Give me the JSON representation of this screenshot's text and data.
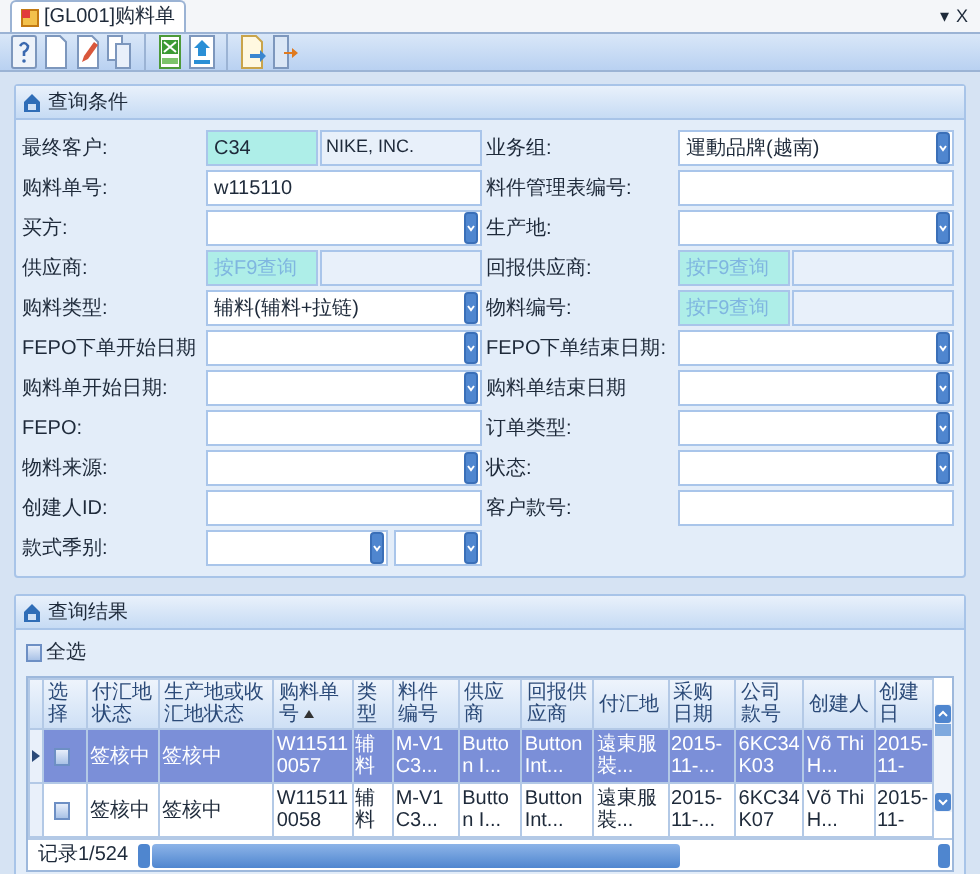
{
  "tab": {
    "title": "[GL001]购料单",
    "selected": true
  },
  "window_controls": [
    "▾",
    "X"
  ],
  "query_panel": {
    "title": "查询条件",
    "rows": [
      {
        "left": {
          "label": "最终客户:",
          "kind": "lookup",
          "code": "C34",
          "name": "NIKE, INC."
        },
        "right": {
          "label": "业务组:",
          "kind": "select",
          "value": "運動品牌(越南)"
        }
      },
      {
        "left": {
          "label": "购料单号:",
          "kind": "text",
          "value": "w115110"
        },
        "right": {
          "label": "料件管理表编号:",
          "kind": "text"
        }
      },
      {
        "left": {
          "label": "买方:",
          "kind": "select"
        },
        "right": {
          "label": "生产地:",
          "kind": "select"
        }
      },
      {
        "left": {
          "label": "供应商:",
          "kind": "lookup",
          "placeholder": "按F9查询"
        },
        "right": {
          "label": "回报供应商:",
          "kind": "lookup",
          "placeholder": "按F9查询"
        }
      },
      {
        "left": {
          "label": "购料类型:",
          "kind": "select",
          "value": "辅料(辅料+拉链)"
        },
        "right": {
          "label": "物料编号:",
          "kind": "lookup",
          "placeholder": "按F9查询"
        }
      },
      {
        "left": {
          "label": "FEPO下单开始日期",
          "kind": "select"
        },
        "right": {
          "label": "FEPO下单结束日期:",
          "kind": "select"
        }
      },
      {
        "left": {
          "label": "购料单开始日期:",
          "kind": "select"
        },
        "right": {
          "label": "购料单结束日期",
          "kind": "select"
        }
      },
      {
        "left": {
          "label": "FEPO:",
          "kind": "text"
        },
        "right": {
          "label": "订单类型:",
          "kind": "select"
        }
      },
      {
        "left": {
          "label": "物料来源:",
          "kind": "select"
        },
        "right": {
          "label": "状态:",
          "kind": "select"
        }
      },
      {
        "left": {
          "label": "创建人ID:",
          "kind": "text"
        },
        "right": {
          "label": "客户款号:",
          "kind": "text"
        }
      },
      {
        "left": {
          "label": "款式季别:",
          "kind": "double-select"
        }
      }
    ]
  },
  "results_panel": {
    "title": "查询结果",
    "select_all": {
      "label": "全选",
      "checked": false
    },
    "table": {
      "select_column": {
        "label": "选择"
      },
      "columns": [
        {
          "label": "付汇地状态",
          "sorted": false
        },
        {
          "label": "生产地或收汇地状态",
          "sorted": false
        },
        {
          "label": "购料单号",
          "sorted": true
        },
        {
          "label": "类型",
          "sorted": false
        },
        {
          "label": "料件编号",
          "sorted": false
        },
        {
          "label": "供应商",
          "sorted": false
        },
        {
          "label": "回报供应商",
          "sorted": false
        },
        {
          "label": "付汇地",
          "sorted": false
        },
        {
          "label": "采购日期",
          "sorted": false
        },
        {
          "label": "公司款号",
          "sorted": false
        },
        {
          "label": "创建人",
          "sorted": false
        },
        {
          "label": "创建日",
          "sorted": false
        }
      ],
      "rows": [
        {
          "selected": true,
          "checked": false,
          "cells": [
            "签核中",
            "签核中",
            "W115110057",
            "辅料",
            "M-V1C3...",
            "Button I...",
            "Button Int...",
            "遠東服裝...",
            "2015-11-...",
            "6KC34K03",
            "Võ Thi H...",
            "2015-11-"
          ]
        },
        {
          "selected": false,
          "checked": false,
          "cells": [
            "签核中",
            "签核中",
            "W115110058",
            "辅料",
            "M-V1C3...",
            "Button I...",
            "Button Int...",
            "遠東服裝...",
            "2015-11-...",
            "6KC34K07",
            "Võ Thi H...",
            "2015-11-"
          ]
        }
      ]
    },
    "record_count": "记录1/524"
  }
}
